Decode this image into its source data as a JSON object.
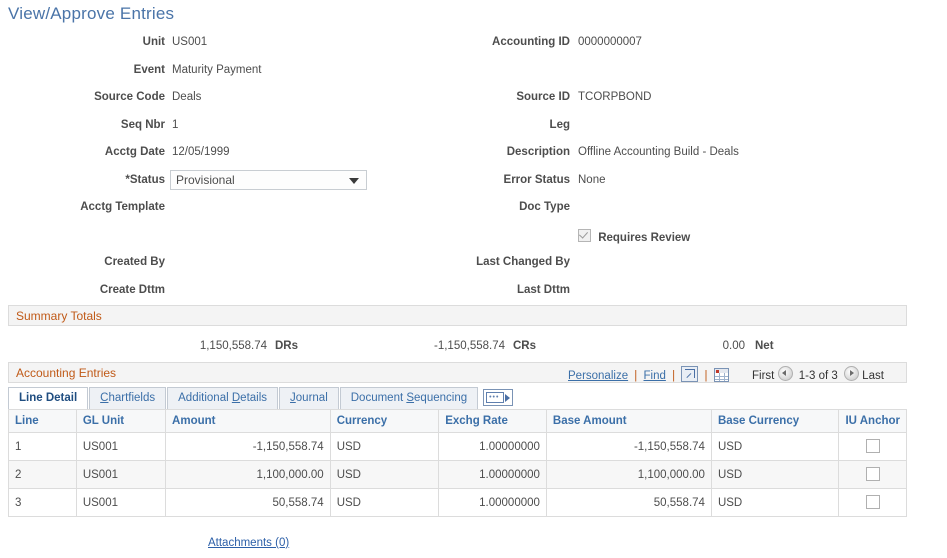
{
  "page": {
    "title": "View/Approve Entries"
  },
  "form": {
    "left": [
      {
        "label": "Unit",
        "value": "US001"
      },
      {
        "label": "Event",
        "value": "Maturity Payment"
      },
      {
        "label": "Source Code",
        "value": "Deals"
      },
      {
        "label": "Seq Nbr",
        "value": "1"
      },
      {
        "label": "Acctg Date",
        "value": "12/05/1999"
      },
      {
        "label": "*Status",
        "value": ""
      },
      {
        "label": "Acctg Template",
        "value": ""
      },
      {
        "label": "",
        "value": ""
      },
      {
        "label": "Created By",
        "value": ""
      },
      {
        "label": "Create Dttm",
        "value": ""
      }
    ],
    "right": [
      {
        "label": "Accounting ID",
        "value": "0000000007"
      },
      {
        "label": "",
        "value": ""
      },
      {
        "label": "Source ID",
        "value": "TCORPBOND"
      },
      {
        "label": "Leg",
        "value": ""
      },
      {
        "label": "Description",
        "value": "Offline Accounting Build  - Deals"
      },
      {
        "label": "Error Status",
        "value": "None"
      },
      {
        "label": "Doc Type",
        "value": ""
      },
      {
        "label": "",
        "value": ""
      },
      {
        "label": "Last Changed By",
        "value": ""
      },
      {
        "label": "Last Dttm",
        "value": ""
      }
    ],
    "status_select": {
      "value": "Provisional"
    },
    "requires_review": {
      "label": "Requires Review",
      "checked": true
    }
  },
  "summary": {
    "section_label": "Summary Totals",
    "drs_value": "1,150,558.74",
    "drs_label": "DRs",
    "crs_value": "-1,150,558.74",
    "crs_label": "CRs",
    "net_value": "0.00",
    "net_label": "Net"
  },
  "entries": {
    "section_label": "Accounting Entries",
    "toolbar": {
      "personalize": "Personalize",
      "find": "Find",
      "sep": "|",
      "popup_icon": "new-window-icon",
      "download_icon": "spreadsheet-icon"
    },
    "pager": {
      "first": "First",
      "range": "1-3 of 3",
      "last": "Last"
    },
    "tabs": [
      {
        "label": "Line Detail",
        "active": true
      },
      {
        "label": "Chartfields",
        "active": false
      },
      {
        "label": "Additional Details",
        "active": false
      },
      {
        "label": "Journal",
        "active": false
      },
      {
        "label": "Document Sequencing",
        "active": false
      }
    ],
    "columns": [
      "Line",
      "GL Unit",
      "Amount",
      "Currency",
      "Exchg Rate",
      "Base Amount",
      "Base Currency",
      "IU Anchor"
    ],
    "rows": [
      {
        "line": "1",
        "gl_unit": "US001",
        "amount": "-1,150,558.74",
        "currency": "USD",
        "exchg_rate": "1.00000000",
        "base_amount": "-1,150,558.74",
        "base_currency": "USD",
        "iu_anchor": false
      },
      {
        "line": "2",
        "gl_unit": "US001",
        "amount": "1,100,000.00",
        "currency": "USD",
        "exchg_rate": "1.00000000",
        "base_amount": "1,100,000.00",
        "base_currency": "USD",
        "iu_anchor": false
      },
      {
        "line": "3",
        "gl_unit": "US001",
        "amount": "50,558.74",
        "currency": "USD",
        "exchg_rate": "1.00000000",
        "base_amount": "50,558.74",
        "base_currency": "USD",
        "iu_anchor": false
      }
    ]
  },
  "attachments": {
    "label": "Attachments (0)"
  },
  "colors": {
    "title": "#4a74a8",
    "section_label": "#c05a18",
    "link": "#3b6fa8",
    "header_text": "#3b6fa8"
  }
}
